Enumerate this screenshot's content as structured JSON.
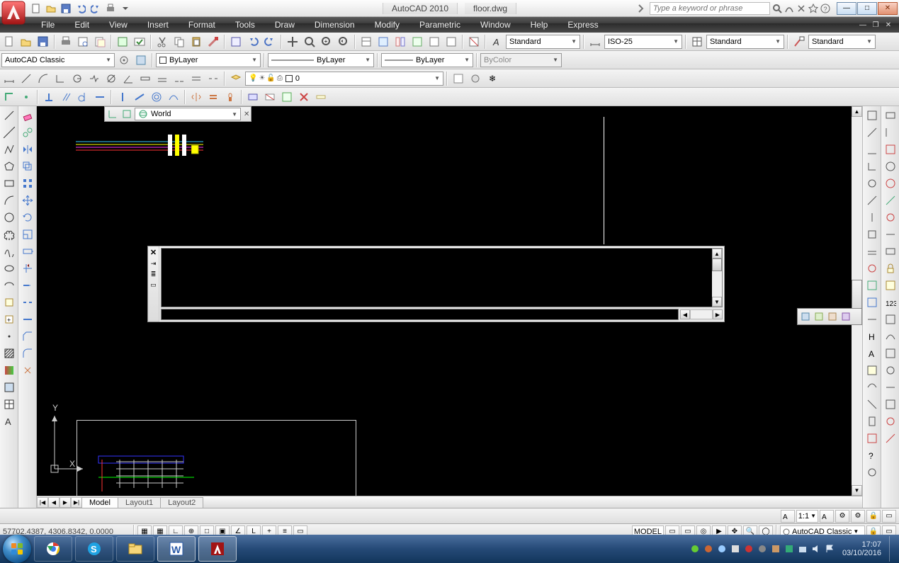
{
  "title": {
    "app": "AutoCAD 2010",
    "doc": "floor.dwg",
    "search_placeholder": "Type a keyword or phrase"
  },
  "menu": [
    "File",
    "Edit",
    "View",
    "Insert",
    "Format",
    "Tools",
    "Draw",
    "Dimension",
    "Modify",
    "Parametric",
    "Window",
    "Help",
    "Express"
  ],
  "row1": {
    "text_style": "Standard",
    "dim_style": "ISO-25",
    "table_style": "Standard",
    "ml_style": "Standard"
  },
  "row2": {
    "workspace": "AutoCAD Classic",
    "layer_color_label": "ByLayer",
    "linetype_label": "ByLayer",
    "lineweight_label": "ByLayer",
    "plotstyle_label": "ByColor",
    "layer_state": "0"
  },
  "ucs_combo": "World",
  "tabs": {
    "model": "Model",
    "layout1": "Layout1",
    "layout2": "Layout2"
  },
  "status": {
    "coords": "57702.4387, 4306.8342, 0.0000",
    "model_space": "MODEL",
    "scale": "1:1",
    "workspace_label": "AutoCAD Classic"
  },
  "ucs_axes": {
    "y": "Y",
    "x": "X"
  },
  "taskbar": {
    "time": "17:07",
    "date": "03/10/2016"
  }
}
